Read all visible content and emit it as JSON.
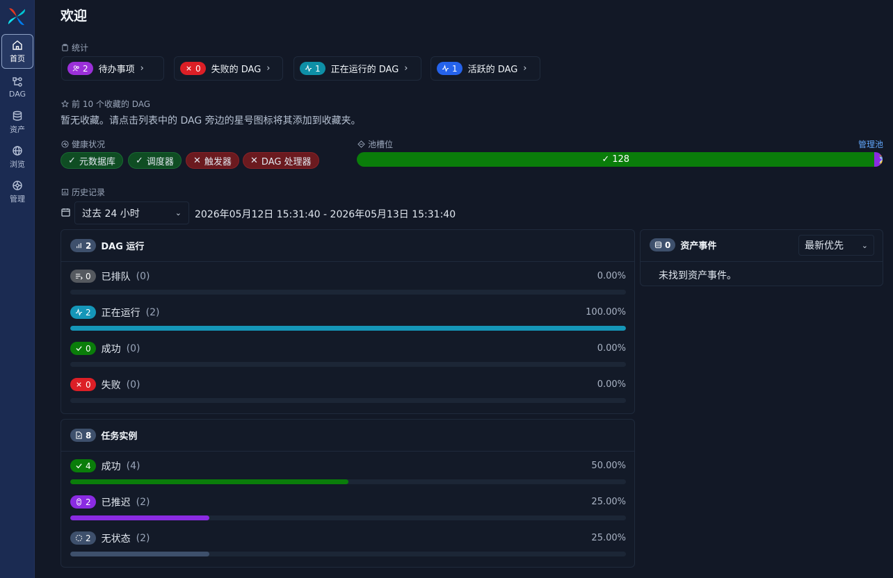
{
  "sidebar": {
    "items": [
      {
        "label": "首页",
        "icon": "home-icon",
        "active": true
      },
      {
        "label": "DAG",
        "icon": "dag-icon",
        "active": false
      },
      {
        "label": "资产",
        "icon": "database-icon",
        "active": false
      },
      {
        "label": "浏览",
        "icon": "globe-icon",
        "active": false
      },
      {
        "label": "管理",
        "icon": "settings-icon",
        "active": false
      }
    ]
  },
  "page_title": "欢迎",
  "stats": {
    "label": "统计",
    "cards": [
      {
        "count": "2",
        "label": "待办事项",
        "color": "#9b30d9",
        "icon": "users-icon"
      },
      {
        "count": "0",
        "label": "失败的 DAG",
        "color": "#dc1f26",
        "icon": "x-icon"
      },
      {
        "count": "1",
        "label": "正在运行的 DAG",
        "color": "#0e8fa6",
        "icon": "activity-icon"
      },
      {
        "count": "1",
        "label": "活跃的 DAG",
        "color": "#2563eb",
        "icon": "activity-icon"
      }
    ]
  },
  "favorites": {
    "label": "前 10 个收藏的 DAG",
    "empty_text": "暂无收藏。请点击列表中的 DAG 旁边的星号图标将其添加到收藏夹。"
  },
  "health": {
    "label": "健康状况",
    "items": [
      {
        "label": "元数据库",
        "ok": true
      },
      {
        "label": "调度器",
        "ok": true
      },
      {
        "label": "触发器",
        "ok": false
      },
      {
        "label": "DAG 处理器",
        "ok": false
      }
    ]
  },
  "pool": {
    "label": "池槽位",
    "manage_label": "管理池",
    "running": "128",
    "deferred": "2",
    "running_color": "#0a7d0a",
    "deferred_color": "#8a2be2"
  },
  "history": {
    "label": "历史记录",
    "range_selected": "过去 24 小时",
    "range_text": "2026年05月12日 15:31:40 - 2026年05月13日 15:31:40"
  },
  "dag_runs": {
    "title": "DAG 运行",
    "count": "2",
    "rows": [
      {
        "count": "0",
        "label": "已排队",
        "paren": "(0)",
        "pct": "0.00%",
        "fraction": 0.0,
        "color": "#55595f",
        "icon": "queue-icon"
      },
      {
        "count": "2",
        "label": "正在运行",
        "paren": "(2)",
        "pct": "100.00%",
        "fraction": 1.0,
        "color": "#1596b8",
        "icon": "activity-icon"
      },
      {
        "count": "0",
        "label": "成功",
        "paren": "(0)",
        "pct": "0.00%",
        "fraction": 0.0,
        "color": "#0a7d0a",
        "icon": "check-icon"
      },
      {
        "count": "0",
        "label": "失败",
        "paren": "(0)",
        "pct": "0.00%",
        "fraction": 0.0,
        "color": "#dc1f26",
        "icon": "x-icon"
      }
    ]
  },
  "task_instances": {
    "title": "任务实例",
    "count": "8",
    "rows": [
      {
        "count": "4",
        "label": "成功",
        "paren": "(4)",
        "pct": "50.00%",
        "fraction": 0.5,
        "color": "#0a7d0a",
        "icon": "check-icon"
      },
      {
        "count": "2",
        "label": "已推迟",
        "paren": "(2)",
        "pct": "25.00%",
        "fraction": 0.25,
        "color": "#8a2be2",
        "icon": "hourglass-icon"
      },
      {
        "count": "2",
        "label": "无状态",
        "paren": "(2)",
        "pct": "25.00%",
        "fraction": 0.25,
        "color": "#3e506c",
        "icon": "circle-dashed-icon"
      }
    ]
  },
  "asset_events": {
    "title": "资产事件",
    "count": "0",
    "sort_selected": "最新优先",
    "empty_text": "未找到资产事件。"
  }
}
